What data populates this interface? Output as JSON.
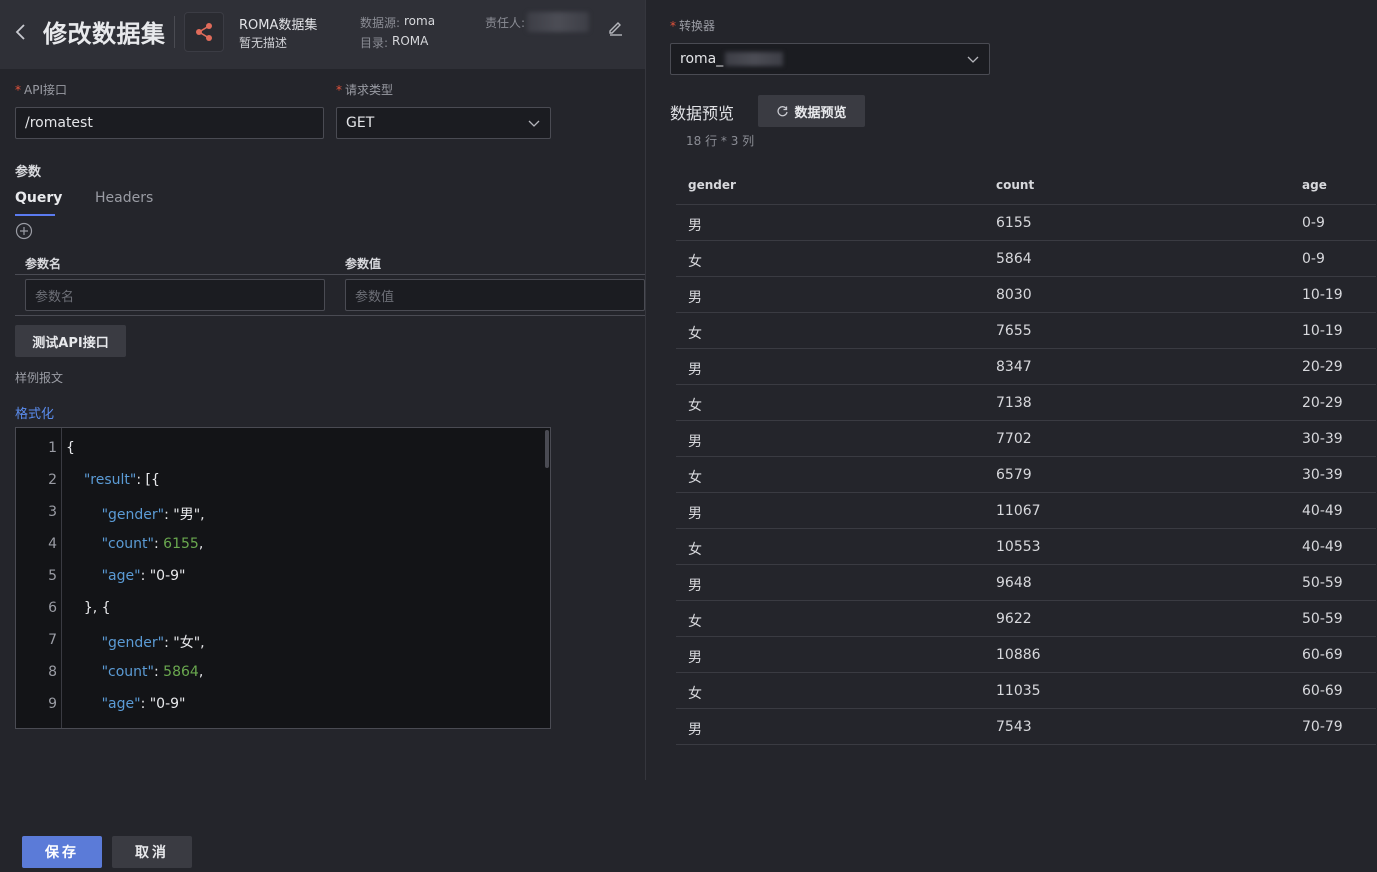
{
  "header": {
    "title": "修改数据集",
    "dataset_name": "ROMA数据集",
    "dataset_desc": "暂无描述",
    "source_label": "数据源:",
    "source_value": "roma",
    "dir_label": "目录:",
    "dir_value": "ROMA",
    "owner_label": "责任人:"
  },
  "form": {
    "api_label": "API接口",
    "api_value": "/romatest",
    "method_label": "请求类型",
    "method_value": "GET",
    "params_title": "参数",
    "tabs": [
      {
        "label": "Query",
        "active": true
      },
      {
        "label": "Headers",
        "active": false
      }
    ],
    "param_name_header": "参数名",
    "param_value_header": "参数值",
    "param_name_placeholder": "参数名",
    "param_value_placeholder": "参数值",
    "test_button": "测试API接口",
    "sample_label": "样例报文",
    "format_link": "格式化"
  },
  "code": {
    "line_numbers": [
      "1",
      "2",
      "3",
      "4",
      "5",
      "6",
      "7",
      "8",
      "9"
    ],
    "lines": [
      {
        "indent": "",
        "key": "",
        "rest": "{",
        "num": ""
      },
      {
        "indent": "    ",
        "key": "\"result\"",
        "rest": ": [{",
        "num": ""
      },
      {
        "indent": "        ",
        "key": "\"gender\"",
        "rest": ": \"男\",",
        "num": ""
      },
      {
        "indent": "        ",
        "key": "\"count\"",
        "rest": ": ",
        "num": "6155",
        "tail": ","
      },
      {
        "indent": "        ",
        "key": "\"age\"",
        "rest": ": \"0-9\"",
        "num": ""
      },
      {
        "indent": "    ",
        "key": "",
        "rest": "}, {",
        "num": ""
      },
      {
        "indent": "        ",
        "key": "\"gender\"",
        "rest": ": \"女\",",
        "num": ""
      },
      {
        "indent": "        ",
        "key": "\"count\"",
        "rest": ": ",
        "num": "5864",
        "tail": ","
      },
      {
        "indent": "        ",
        "key": "\"age\"",
        "rest": ": \"0-9\"",
        "num": ""
      }
    ]
  },
  "right": {
    "converter_label": "转换器",
    "converter_value": "roma_",
    "preview_title": "数据预览",
    "preview_button": "数据预览",
    "row_info": "18 行 * 3 列",
    "columns": [
      "gender",
      "count",
      "age"
    ],
    "rows": [
      [
        "男",
        "6155",
        "0-9"
      ],
      [
        "女",
        "5864",
        "0-9"
      ],
      [
        "男",
        "8030",
        "10-19"
      ],
      [
        "女",
        "7655",
        "10-19"
      ],
      [
        "男",
        "8347",
        "20-29"
      ],
      [
        "女",
        "7138",
        "20-29"
      ],
      [
        "男",
        "7702",
        "30-39"
      ],
      [
        "女",
        "6579",
        "30-39"
      ],
      [
        "男",
        "11067",
        "40-49"
      ],
      [
        "女",
        "10553",
        "40-49"
      ],
      [
        "男",
        "9648",
        "50-59"
      ],
      [
        "女",
        "9622",
        "50-59"
      ],
      [
        "男",
        "10886",
        "60-69"
      ],
      [
        "女",
        "11035",
        "60-69"
      ],
      [
        "男",
        "7543",
        "70-79"
      ]
    ]
  },
  "footer": {
    "save": "保存",
    "cancel": "取消"
  }
}
